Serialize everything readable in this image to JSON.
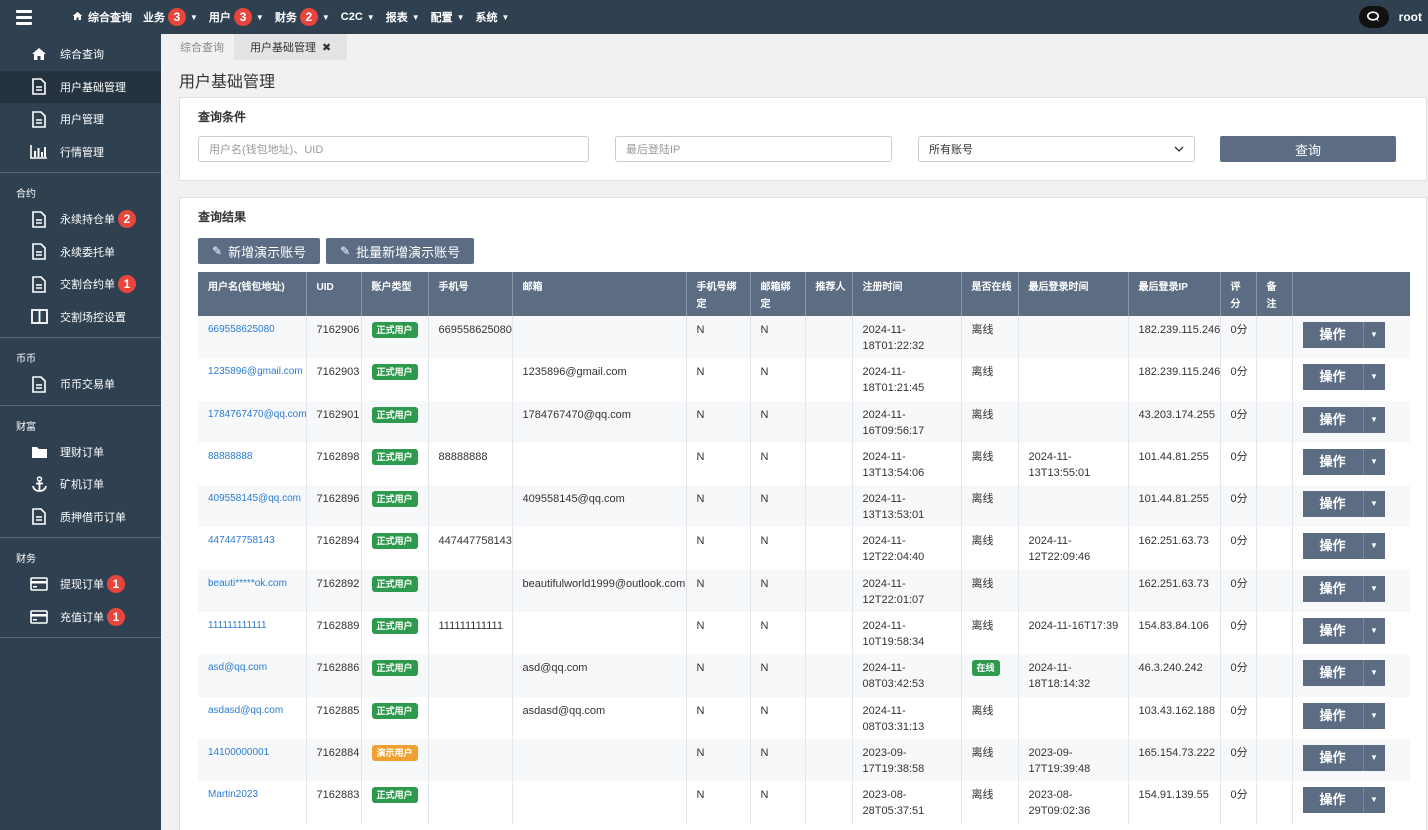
{
  "topbar": {
    "menu": [
      {
        "label": "综合查询",
        "icon": "home-icon",
        "badge": "",
        "caret": false
      },
      {
        "label": "业务",
        "badge": "3",
        "caret": true
      },
      {
        "label": "用户",
        "badge": "3",
        "caret": true
      },
      {
        "label": "财务",
        "badge": "2",
        "caret": true
      },
      {
        "label": "C2C",
        "badge": "",
        "caret": true
      },
      {
        "label": "报表",
        "badge": "",
        "caret": true
      },
      {
        "label": "配置",
        "badge": "",
        "caret": true
      },
      {
        "label": "系统",
        "badge": "",
        "caret": true
      }
    ],
    "user": "root"
  },
  "sidebar": {
    "groups": [
      {
        "title": "",
        "items": [
          {
            "label": "综合查询",
            "icon": "home-icon",
            "badge": "",
            "active": false
          },
          {
            "label": "用户基础管理",
            "icon": "file-icon",
            "badge": "",
            "active": true
          },
          {
            "label": "用户管理",
            "icon": "file-icon",
            "badge": "",
            "active": false
          },
          {
            "label": "行情管理",
            "icon": "bar-chart-icon",
            "badge": "",
            "active": false
          }
        ]
      },
      {
        "title": "合约",
        "items": [
          {
            "label": "永续持仓单",
            "icon": "file-icon",
            "badge": "2",
            "active": false
          },
          {
            "label": "永续委托单",
            "icon": "file-icon",
            "badge": "",
            "active": false
          },
          {
            "label": "交割合约单",
            "icon": "file-icon",
            "badge": "1",
            "active": false
          },
          {
            "label": "交割场控设置",
            "icon": "columns-icon",
            "badge": "",
            "active": false
          }
        ]
      },
      {
        "title": "币币",
        "items": [
          {
            "label": "币币交易单",
            "icon": "file-icon",
            "badge": "",
            "active": false
          }
        ]
      },
      {
        "title": "财富",
        "items": [
          {
            "label": "理财订单",
            "icon": "folder-icon",
            "badge": "",
            "active": false
          },
          {
            "label": "矿机订单",
            "icon": "anchor-icon",
            "badge": "",
            "active": false
          },
          {
            "label": "质押借币订单",
            "icon": "file-icon",
            "badge": "",
            "active": false
          }
        ]
      },
      {
        "title": "财务",
        "items": [
          {
            "label": "提现订单",
            "icon": "card-icon",
            "badge": "1",
            "active": false
          },
          {
            "label": "充值订单",
            "icon": "card-icon",
            "badge": "1",
            "active": false
          }
        ]
      }
    ]
  },
  "tabs": [
    {
      "label": "综合查询",
      "active": false
    },
    {
      "label": "用户基础管理",
      "active": true,
      "close": "✖"
    }
  ],
  "page_title": "用户基础管理",
  "query": {
    "title": "查询条件",
    "username_placeholder": "用户名(钱包地址)、UID",
    "ip_placeholder": "最后登陆IP",
    "account_select": "所有账号",
    "button": "查询"
  },
  "results": {
    "title": "查询结果",
    "add_demo": "新增演示账号",
    "batch_add_demo": "批量新增演示账号",
    "columns": [
      "用户名(钱包地址)",
      "UID",
      "账户类型",
      "手机号",
      "邮箱",
      "手机号绑定",
      "邮箱绑定",
      "推荐人",
      "注册时间",
      "是否在线",
      "最后登录时间",
      "最后登录IP",
      "评分",
      "备注",
      ""
    ],
    "op_label": "操作",
    "rows": [
      {
        "user": "669558625080",
        "uid": "7162906",
        "type": "正式用户",
        "type_kind": "formal",
        "phone": "669558625080",
        "email": "",
        "phone_bind": "N",
        "email_bind": "N",
        "referrer": "",
        "reg": "2024-11-18T01:22:32",
        "online": "离线",
        "last_login": "",
        "ip": "182.239.115.246",
        "score": "0分",
        "note": ""
      },
      {
        "user": "1235896@gmail.com",
        "uid": "7162903",
        "type": "正式用户",
        "type_kind": "formal",
        "phone": "",
        "email": "1235896@gmail.com",
        "phone_bind": "N",
        "email_bind": "N",
        "referrer": "",
        "reg": "2024-11-18T01:21:45",
        "online": "离线",
        "last_login": "",
        "ip": "182.239.115.246",
        "score": "0分",
        "note": ""
      },
      {
        "user": "1784767470@qq.com",
        "uid": "7162901",
        "type": "正式用户",
        "type_kind": "formal",
        "phone": "",
        "email": "1784767470@qq.com",
        "phone_bind": "N",
        "email_bind": "N",
        "referrer": "",
        "reg": "2024-11-16T09:56:17",
        "online": "离线",
        "last_login": "",
        "ip": "43.203.174.255",
        "score": "0分",
        "note": ""
      },
      {
        "user": "88888888",
        "uid": "7162898",
        "type": "正式用户",
        "type_kind": "formal",
        "phone": "88888888",
        "email": "",
        "phone_bind": "N",
        "email_bind": "N",
        "referrer": "",
        "reg": "2024-11-13T13:54:06",
        "online": "离线",
        "last_login": "2024-11-13T13:55:01",
        "ip": "101.44.81.255",
        "score": "0分",
        "note": ""
      },
      {
        "user": "409558145@qq.com",
        "uid": "7162896",
        "type": "正式用户",
        "type_kind": "formal",
        "phone": "",
        "email": "409558145@qq.com",
        "phone_bind": "N",
        "email_bind": "N",
        "referrer": "",
        "reg": "2024-11-13T13:53:01",
        "online": "离线",
        "last_login": "",
        "ip": "101.44.81.255",
        "score": "0分",
        "note": ""
      },
      {
        "user": "447447758143",
        "uid": "7162894",
        "type": "正式用户",
        "type_kind": "formal",
        "phone": "447447758143",
        "email": "",
        "phone_bind": "N",
        "email_bind": "N",
        "referrer": "",
        "reg": "2024-11-12T22:04:40",
        "online": "离线",
        "last_login": "2024-11-12T22:09:46",
        "ip": "162.251.63.73",
        "score": "0分",
        "note": ""
      },
      {
        "user": "beauti*****ok.com",
        "uid": "7162892",
        "type": "正式用户",
        "type_kind": "formal",
        "phone": "",
        "email": "beautifulworld1999@outlook.com",
        "phone_bind": "N",
        "email_bind": "N",
        "referrer": "",
        "reg": "2024-11-12T22:01:07",
        "online": "离线",
        "last_login": "",
        "ip": "162.251.63.73",
        "score": "0分",
        "note": ""
      },
      {
        "user": "111111111111",
        "uid": "7162889",
        "type": "正式用户",
        "type_kind": "formal",
        "phone": "111111111111",
        "email": "",
        "phone_bind": "N",
        "email_bind": "N",
        "referrer": "",
        "reg": "2024-11-10T19:58:34",
        "online": "离线",
        "last_login": "2024-11-16T17:39",
        "ip": "154.83.84.106",
        "score": "0分",
        "note": ""
      },
      {
        "user": "asd@qq.com",
        "uid": "7162886",
        "type": "正式用户",
        "type_kind": "formal",
        "phone": "",
        "email": "asd@qq.com",
        "phone_bind": "N",
        "email_bind": "N",
        "referrer": "",
        "reg": "2024-11-08T03:42:53",
        "online": "在线",
        "last_login": "2024-11-18T18:14:32",
        "ip": "46.3.240.242",
        "score": "0分",
        "note": ""
      },
      {
        "user": "asdasd@qq.com",
        "uid": "7162885",
        "type": "正式用户",
        "type_kind": "formal",
        "phone": "",
        "email": "asdasd@qq.com",
        "phone_bind": "N",
        "email_bind": "N",
        "referrer": "",
        "reg": "2024-11-08T03:31:13",
        "online": "离线",
        "last_login": "",
        "ip": "103.43.162.188",
        "score": "0分",
        "note": ""
      },
      {
        "user": "14100000001",
        "uid": "7162884",
        "type": "演示用户",
        "type_kind": "demo",
        "phone": "",
        "email": "",
        "phone_bind": "N",
        "email_bind": "N",
        "referrer": "",
        "reg": "2023-09-17T19:38:58",
        "online": "离线",
        "last_login": "2023-09-17T19:39:48",
        "ip": "165.154.73.222",
        "score": "0分",
        "note": ""
      },
      {
        "user": "Martin2023",
        "uid": "7162883",
        "type": "正式用户",
        "type_kind": "formal",
        "phone": "",
        "email": "",
        "phone_bind": "N",
        "email_bind": "N",
        "referrer": "",
        "reg": "2023-08-28T05:37:51",
        "online": "离线",
        "last_login": "2023-08-29T09:02:36",
        "ip": "154.91.139.55",
        "score": "0分",
        "note": ""
      }
    ]
  }
}
